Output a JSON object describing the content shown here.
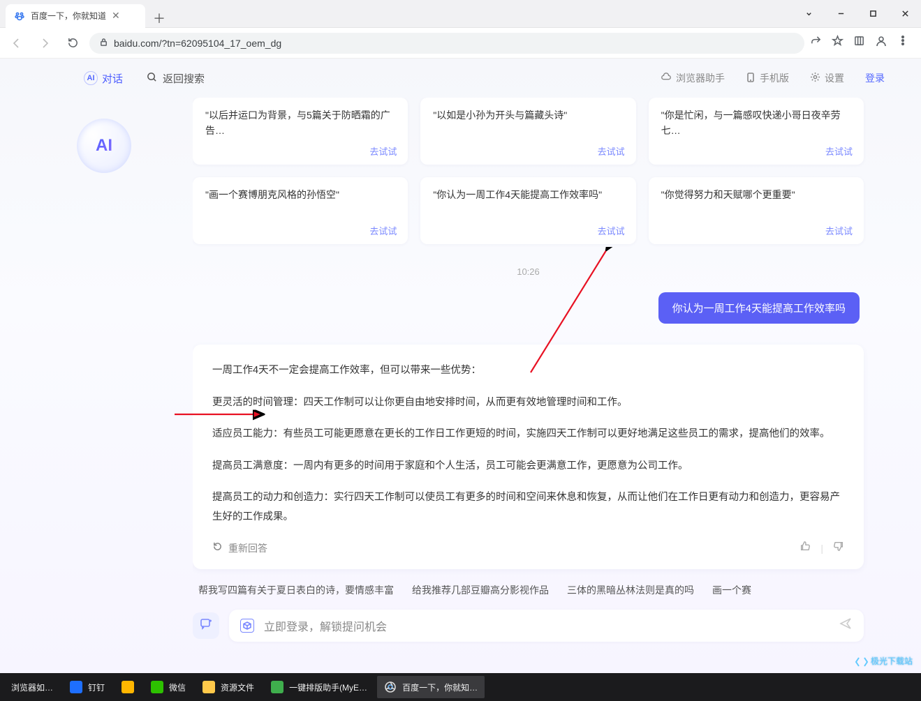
{
  "browser": {
    "tab_title": "百度一下，你就知道",
    "url": "baidu.com/?tn=62095104_17_oem_dg"
  },
  "topbar": {
    "dialog_label": "对话",
    "dialog_icon_text": "AI",
    "back_to_search": "返回搜索",
    "right": {
      "assistant": "浏览器助手",
      "mobile": "手机版",
      "settings": "设置",
      "login": "登录"
    }
  },
  "logo_text": "AI",
  "cards_top": [
    {
      "title": "\"以后并运口为背景，与5篇关于防晒霜的广告…",
      "try": "去试试"
    },
    {
      "title": "\"以如是小孙为开头与篇藏头诗\"",
      "try": "去试试"
    },
    {
      "title": "\"你是忙闲，与一篇感叹快递小哥日夜辛劳七…",
      "try": "去试试"
    }
  ],
  "cards_bottom": [
    {
      "title": "\"画一个赛博朋克风格的孙悟空\"",
      "try": "去试试"
    },
    {
      "title": "\"你认为一周工作4天能提高工作效率吗\"",
      "try": "去试试"
    },
    {
      "title": "\"你觉得努力和天赋哪个更重要\"",
      "try": "去试试"
    }
  ],
  "timestamp": "10:26",
  "user_message": "你认为一周工作4天能提高工作效率吗",
  "answer": {
    "p1": "一周工作4天不一定会提高工作效率，但可以带来一些优势：",
    "p2": "更灵活的时间管理：四天工作制可以让你更自由地安排时间，从而更有效地管理时间和工作。",
    "p3": "适应员工能力：有些员工可能更愿意在更长的工作日工作更短的时间，实施四天工作制可以更好地满足这些员工的需求，提高他们的效率。",
    "p4": "提高员工满意度：一周内有更多的时间用于家庭和个人生活，员工可能会更满意工作，更愿意为公司工作。",
    "p5": "提高员工的动力和创造力：实行四天工作制可以使员工有更多的时间和空间来休息和恢复，从而让他们在工作日更有动力和创造力，更容易产生好的工作成果。",
    "regen_label": "重新回答"
  },
  "chips": [
    "帮我写四篇有关于夏日表白的诗，要情感丰富",
    "给我推荐几部豆瓣高分影视作品",
    "三体的黑暗丛林法则是真的吗",
    "画一个赛"
  ],
  "prompt": {
    "placeholder": "立即登录，解锁提问机会"
  },
  "taskbar": {
    "items": [
      "浏览器如…",
      "钉钉",
      "",
      "微信",
      "资源文件",
      "一键排版助手(MyE…",
      "百度一下，你就知…"
    ]
  },
  "watermark": "极光下载站"
}
